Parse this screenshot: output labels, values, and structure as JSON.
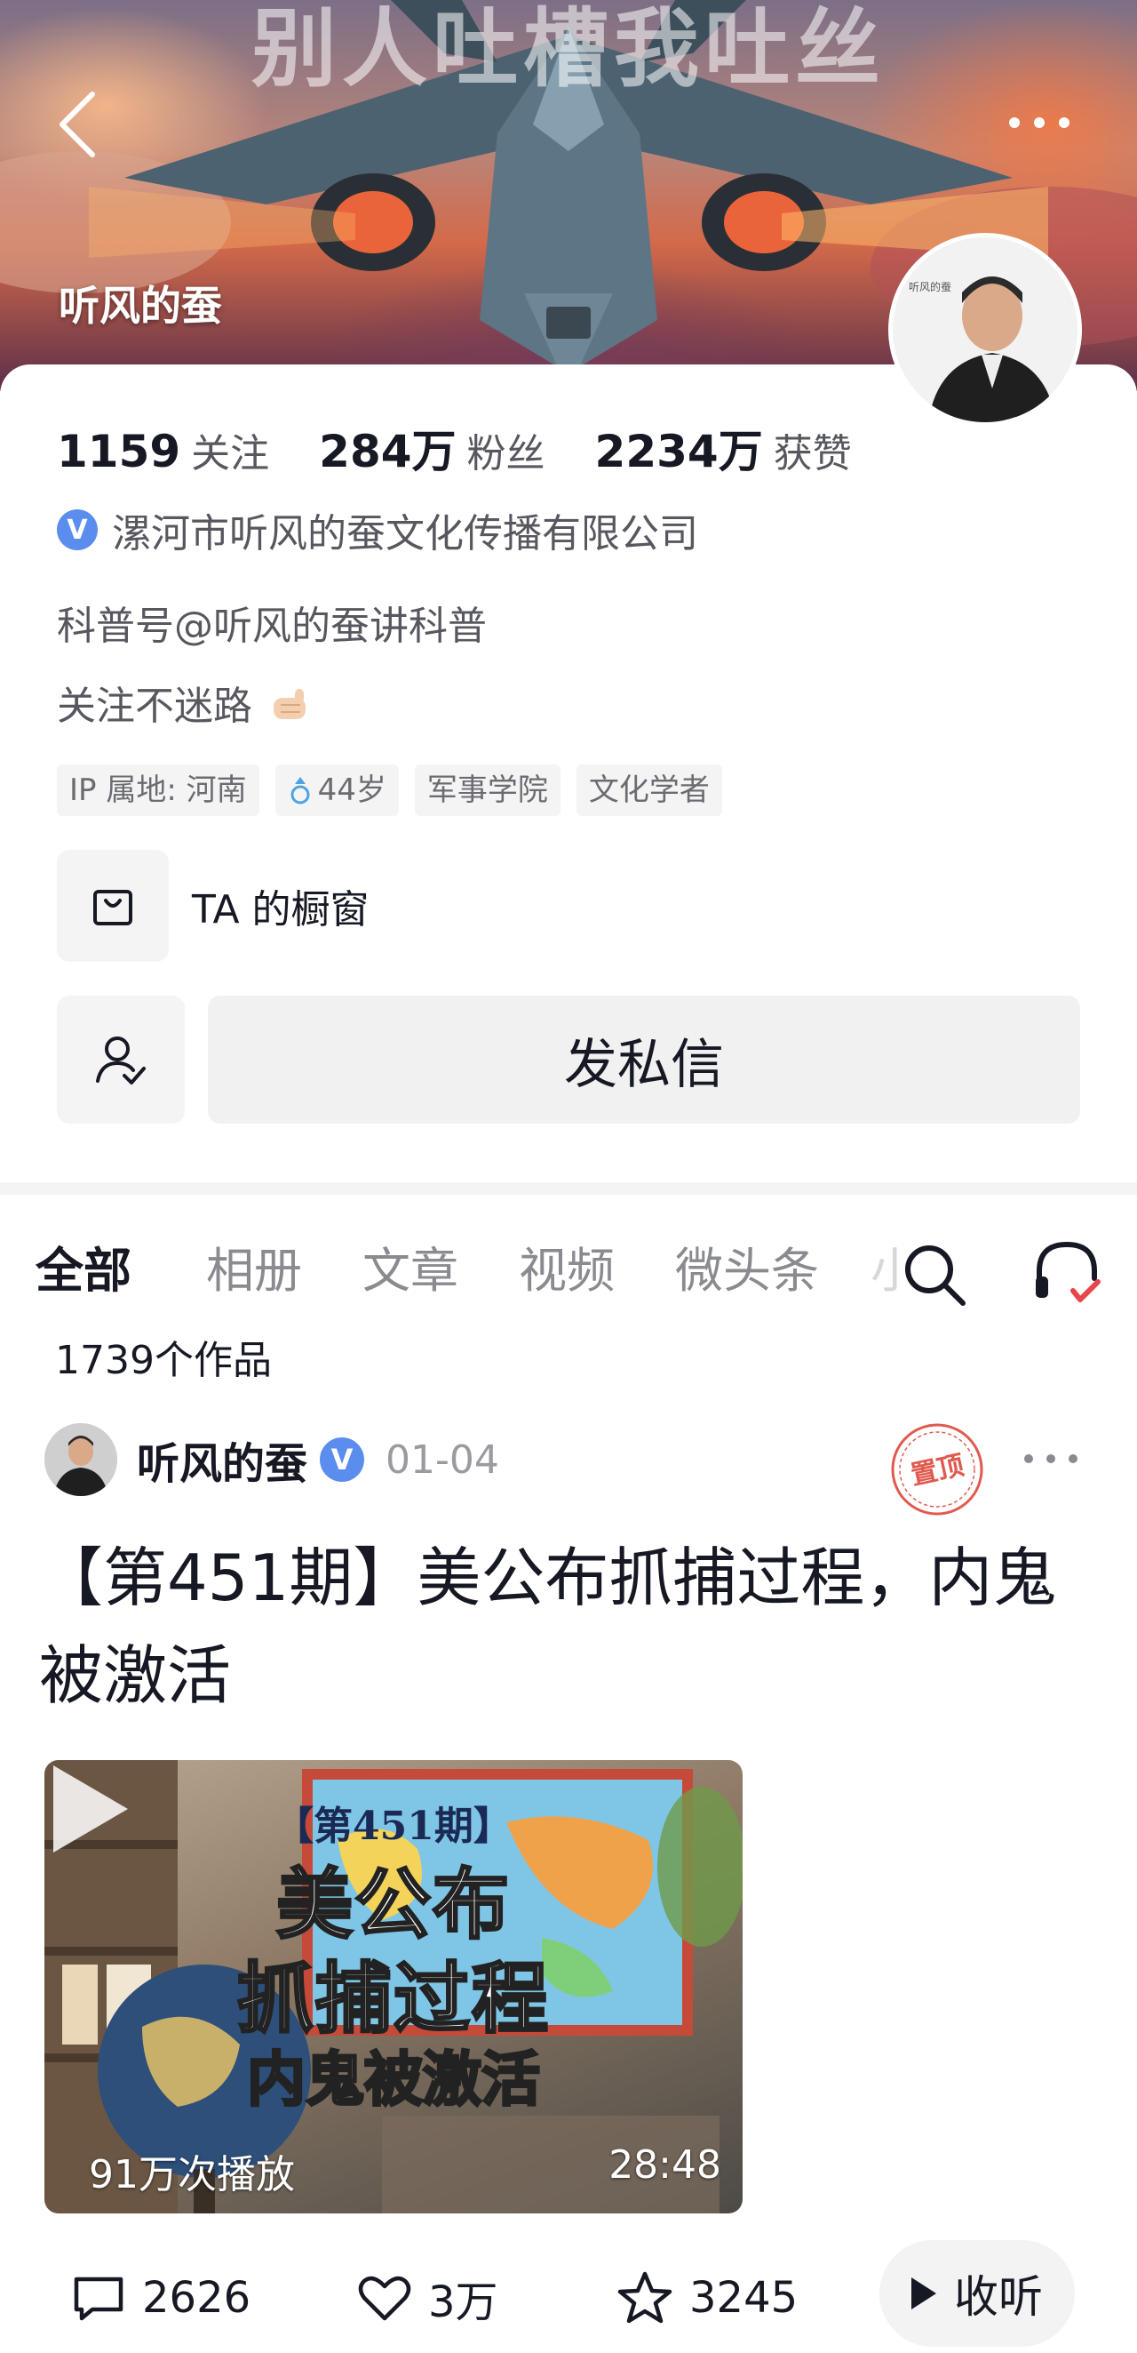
{
  "header": {
    "banner_text": "别人吐槽我吐丝",
    "username": "听风的蚕",
    "icons": {
      "back": "back-arrow-icon",
      "more": "more-dots-icon"
    }
  },
  "profile": {
    "stats": [
      {
        "value": "1159",
        "label": "关注"
      },
      {
        "value": "284万",
        "label": "粉丝"
      },
      {
        "value": "2234万",
        "label": "获赞"
      }
    ],
    "verification": "漯河市听风的蚕文化传播有限公司",
    "verified_badge": "V",
    "bio_line1": "科普号@听风的蚕讲科普",
    "bio_line2": "关注不迷路",
    "tags": [
      "IP 属地: 河南",
      "44岁",
      "军事学院",
      "文化学者"
    ],
    "shop_label": "TA 的橱窗",
    "message_button": "发私信"
  },
  "tabs": {
    "items": [
      "全部",
      "相册",
      "文章",
      "视频",
      "微头条"
    ],
    "active": "全部",
    "overflow_hint": "小"
  },
  "works_count": "1739个作品",
  "post": {
    "author": "听风的蚕",
    "verified_badge": "V",
    "date": "01-04",
    "pin_label": "置顶",
    "title": "【第451期】美公布抓捕过程，内鬼被激活",
    "video": {
      "line1": "【第451期】",
      "line2": "美公布",
      "line3": "抓捕过程",
      "line4": "内鬼被激活",
      "plays": "91万次播放",
      "duration": "28:48"
    },
    "actions": {
      "comments": "2626",
      "likes": "3万",
      "favorites": "3245",
      "listen": "收听"
    }
  },
  "colors": {
    "verified_blue": "#5b8def",
    "primary_text": "#161823",
    "secondary_text": "#57585f",
    "tag_bg": "#f4f4f5",
    "pin_red": "#e05a4f"
  }
}
